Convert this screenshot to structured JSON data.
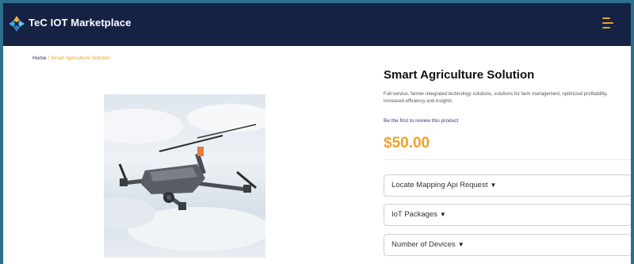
{
  "header": {
    "brand": "TeC IOT Marketplace",
    "accent": "#e3a321",
    "bg": "#152244"
  },
  "breadcrumb": {
    "home": "Home",
    "separator": "/",
    "current": "Smart Agriculture Solution"
  },
  "product": {
    "title": "Smart Agriculture Solution",
    "description": "Full-service, farmer-integrated technology solutions, solutions for farm management, optimized profitability, increased efficiency and insights.",
    "review_link": "Be the first to review this product",
    "price": "$50.00",
    "price_color": "#f0a22b",
    "image_alt": "drone"
  },
  "options": {
    "mapping": "Locate Mapping Api Request",
    "packages": "IoT Packages",
    "devices": "Number of Devices"
  },
  "icons": {
    "logo": "tec-logo-icon",
    "menu": "hamburger-icon",
    "chevron": "chevron-down-icon"
  }
}
